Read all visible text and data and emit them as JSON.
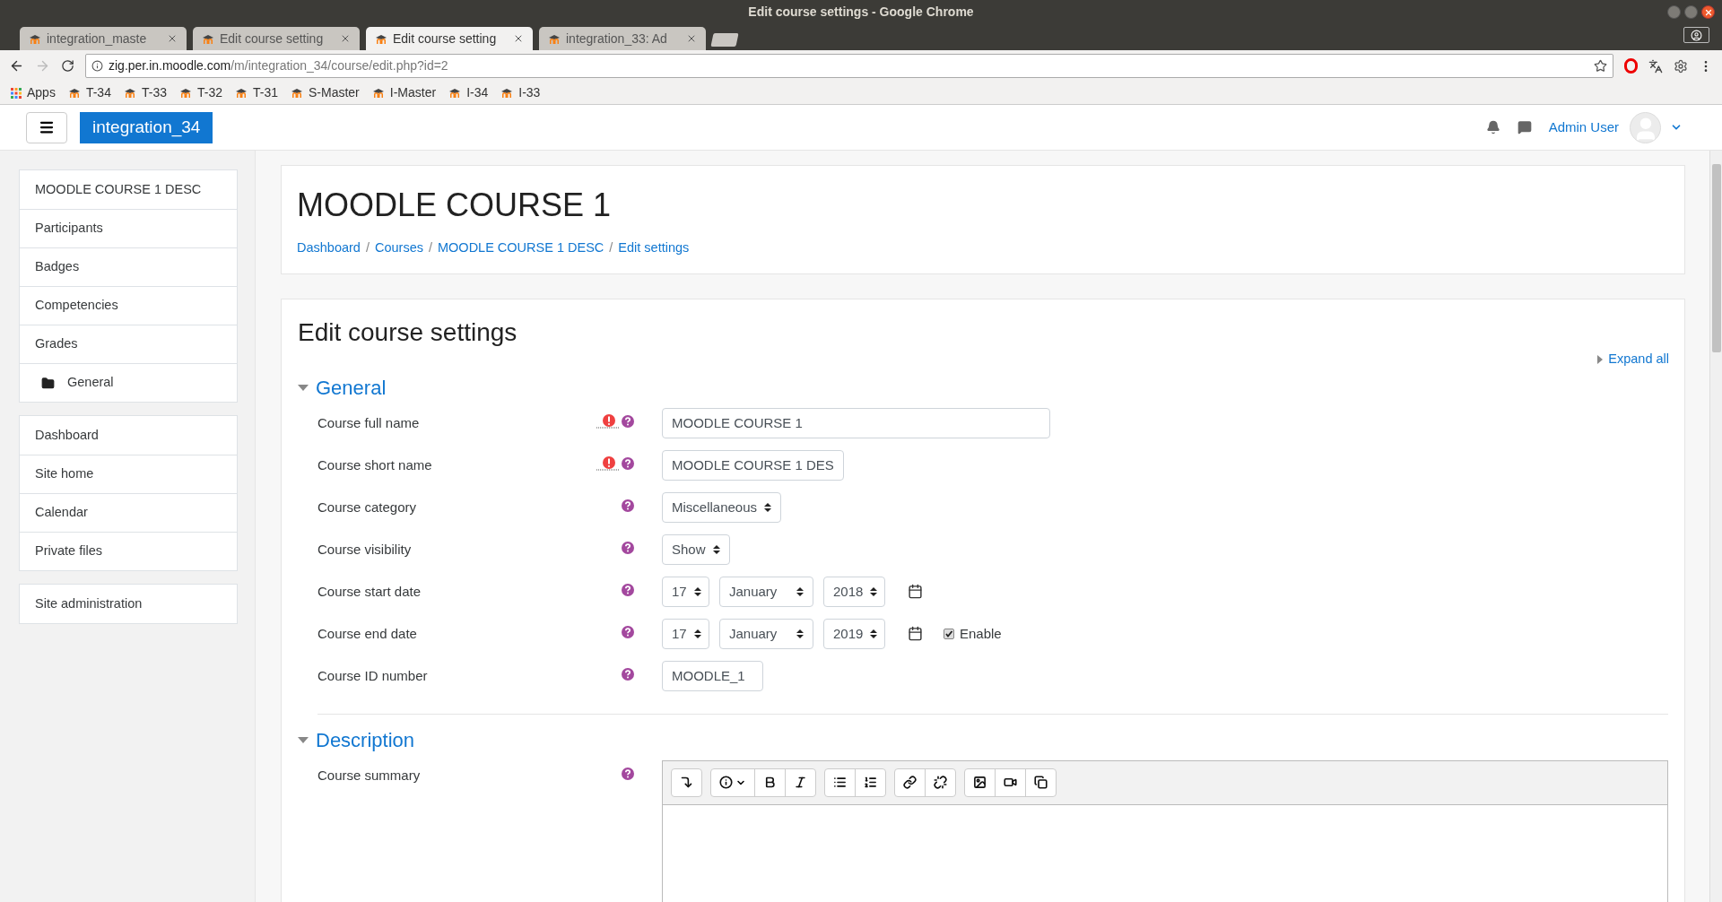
{
  "window": {
    "title": "Edit course settings - Google Chrome"
  },
  "browser_tabs": [
    {
      "label": "integration_maste",
      "selected": false
    },
    {
      "label": "Edit course setting",
      "selected": false
    },
    {
      "label": "Edit course setting",
      "selected": true
    },
    {
      "label": "integration_33: Ad",
      "selected": false
    }
  ],
  "address_bar": {
    "host": "zig.per.in.moodle.com",
    "path": "/m/integration_34/course/edit.php?id=2"
  },
  "bookmarks": [
    "Apps",
    "T-34",
    "T-33",
    "T-32",
    "T-31",
    "S-Master",
    "I-Master",
    "I-34",
    "I-33"
  ],
  "header": {
    "brand": "integration_34",
    "user": "Admin User"
  },
  "sidebar": {
    "groups": [
      [
        {
          "label": "MOODLE COURSE 1 DESC",
          "indent": false
        },
        {
          "label": "Participants",
          "indent": false
        },
        {
          "label": "Badges",
          "indent": false
        },
        {
          "label": "Competencies",
          "indent": false
        },
        {
          "label": "Grades",
          "indent": false
        },
        {
          "label": "General",
          "indent": true
        }
      ],
      [
        {
          "label": "Dashboard",
          "indent": false
        },
        {
          "label": "Site home",
          "indent": false
        },
        {
          "label": "Calendar",
          "indent": false
        },
        {
          "label": "Private files",
          "indent": false
        }
      ],
      [
        {
          "label": "Site administration",
          "indent": false
        }
      ]
    ]
  },
  "page_title": "MOODLE COURSE 1",
  "breadcrumb": [
    {
      "label": "Dashboard"
    },
    {
      "separator": "/",
      "label": "Courses"
    },
    {
      "separator": "/",
      "label": "MOODLE COURSE 1 DESC"
    },
    {
      "separator": "/",
      "label": "Edit settings"
    }
  ],
  "form": {
    "title": "Edit course settings",
    "expand_all": "Expand all",
    "sections": [
      {
        "title": "General",
        "expanded": true,
        "rows": [
          {
            "kind": "text",
            "label": "Course full name",
            "required": true,
            "value": "MOODLE COURSE 1"
          },
          {
            "kind": "text",
            "label": "Course short name",
            "required": true,
            "value": "MOODLE COURSE 1 DES"
          },
          {
            "kind": "select",
            "label": "Course category",
            "required": false,
            "value": "Miscellaneous"
          },
          {
            "kind": "select",
            "label": "Course visibility",
            "required": false,
            "value": "Show"
          },
          {
            "kind": "date",
            "label": "Course start date",
            "required": false,
            "day": "17",
            "month": "January",
            "year": "2018"
          },
          {
            "kind": "date",
            "label": "Course end date",
            "required": false,
            "day": "17",
            "month": "January",
            "year": "2019",
            "enable": {
              "label": "Enable",
              "checked": true
            }
          },
          {
            "kind": "text",
            "label": "Course ID number",
            "required": false,
            "value": "MOODLE_1"
          }
        ]
      },
      {
        "title": "Description",
        "expanded": true,
        "rows": [
          {
            "kind": "editor",
            "label": "Course summary",
            "required": false
          }
        ]
      }
    ]
  }
}
